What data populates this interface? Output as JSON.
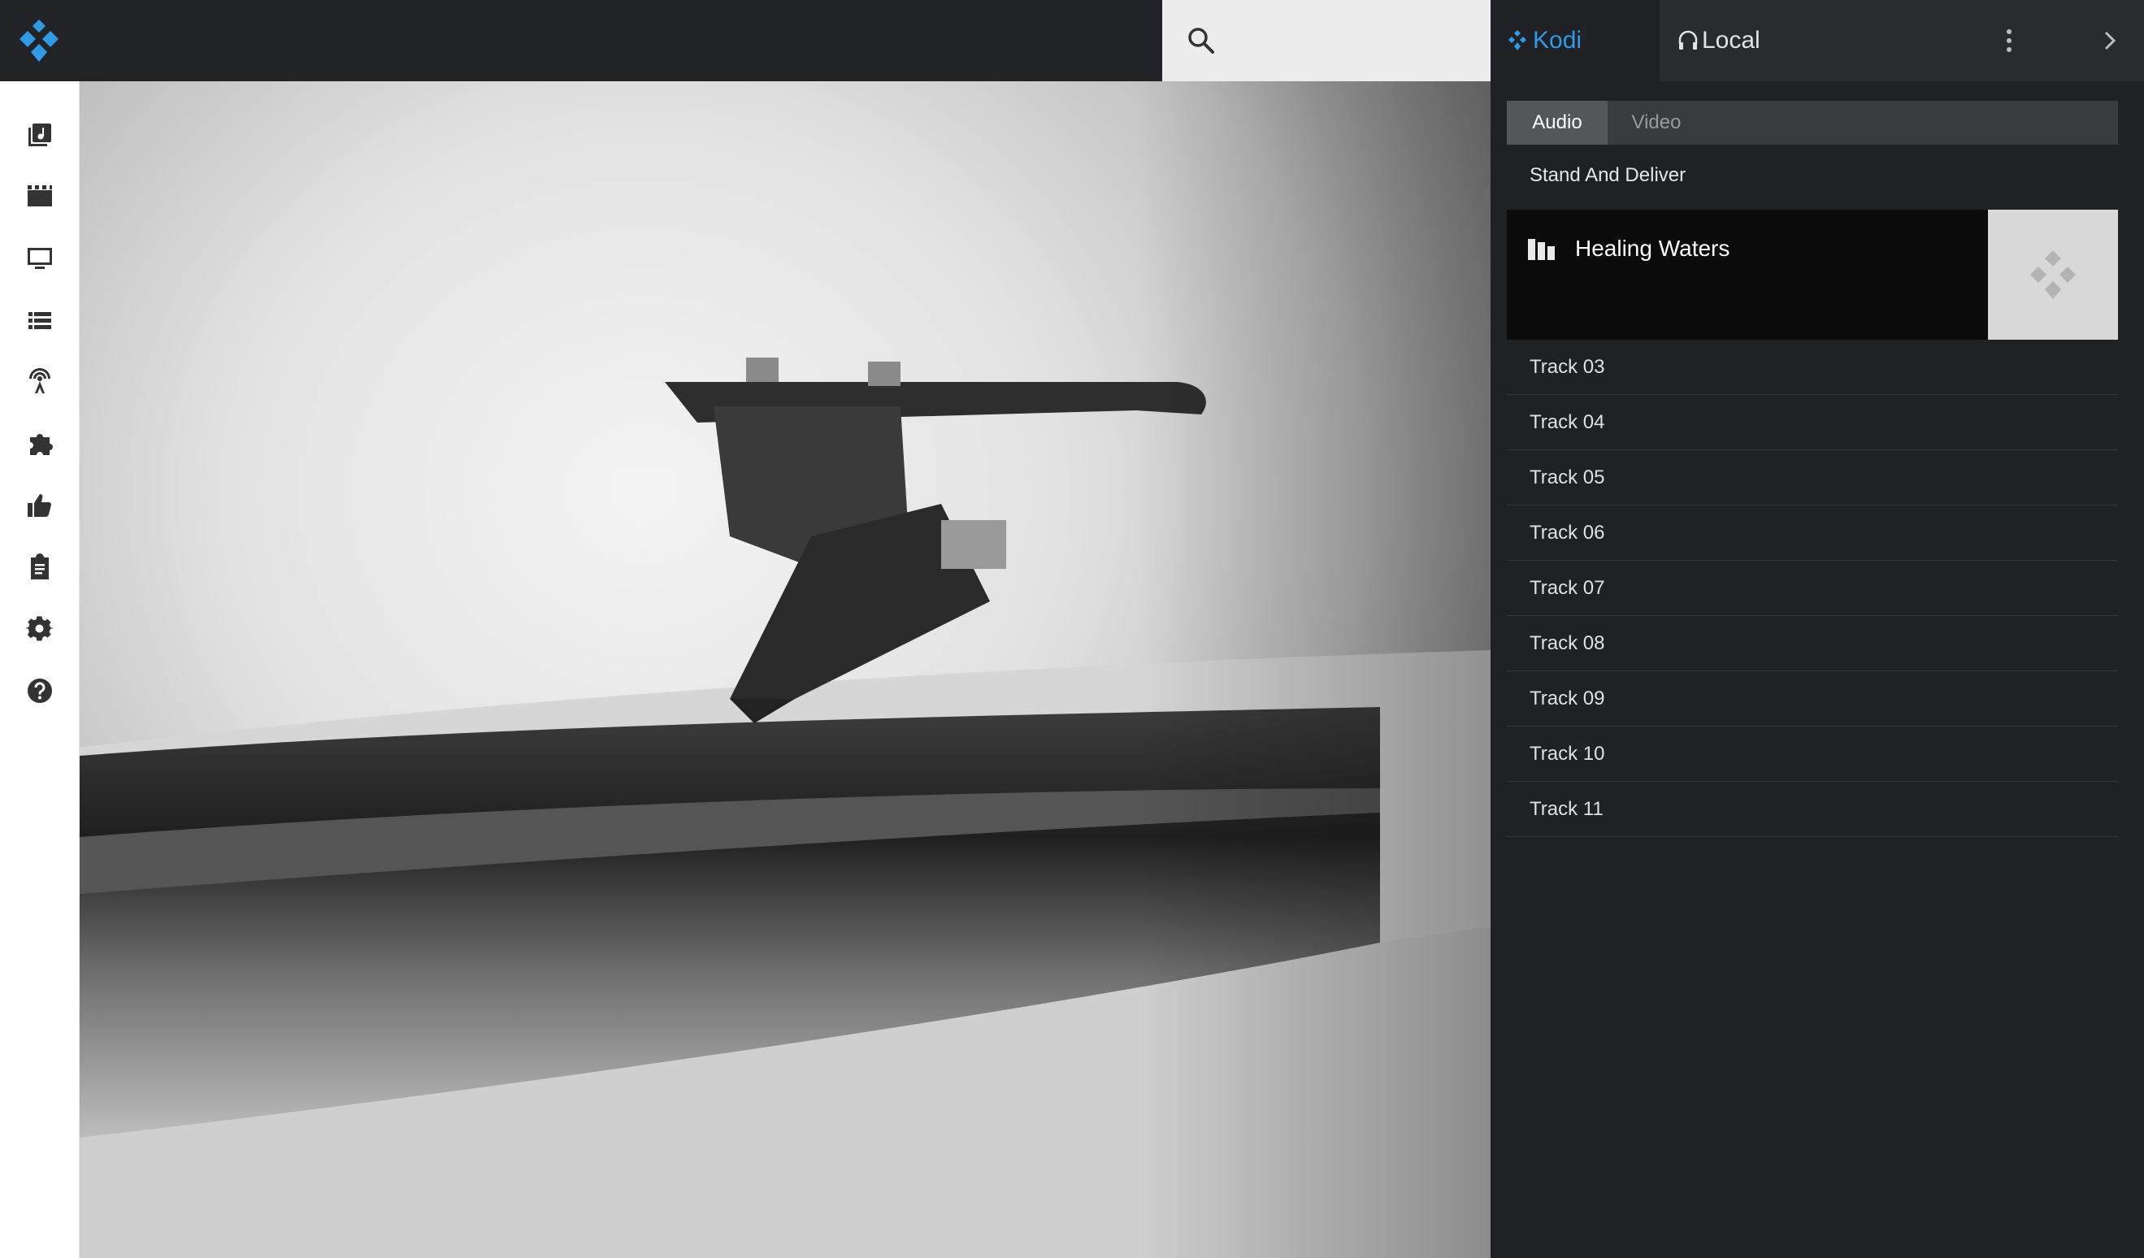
{
  "app": {
    "brand_color": "#2f9ae6"
  },
  "search": {
    "icon": "search-icon",
    "placeholder": ""
  },
  "leftnav": {
    "items": [
      {
        "name": "music",
        "icon": "music-library-icon"
      },
      {
        "name": "movies",
        "icon": "movie-clapper-icon"
      },
      {
        "name": "tv-shows",
        "icon": "tv-monitor-icon"
      },
      {
        "name": "browser",
        "icon": "list-icon"
      },
      {
        "name": "pvr",
        "icon": "broadcast-antenna-icon"
      },
      {
        "name": "addons",
        "icon": "puzzle-piece-icon"
      },
      {
        "name": "thumbs-up",
        "icon": "thumbs-up-icon"
      },
      {
        "name": "playlists",
        "icon": "clipboard-icon"
      },
      {
        "name": "settings",
        "icon": "gear-icon"
      },
      {
        "name": "help",
        "icon": "help-circle-icon"
      }
    ]
  },
  "panel": {
    "tabs": {
      "kodi": "Kodi",
      "local": "Local"
    },
    "subtabs": {
      "audio": "Audio",
      "video": "Video"
    },
    "album": "Stand And Deliver",
    "now_playing": "Healing Waters",
    "tracks": [
      "Track 03",
      "Track 04",
      "Track 05",
      "Track 06",
      "Track 07",
      "Track 08",
      "Track 09",
      "Track 10",
      "Track 11"
    ]
  }
}
